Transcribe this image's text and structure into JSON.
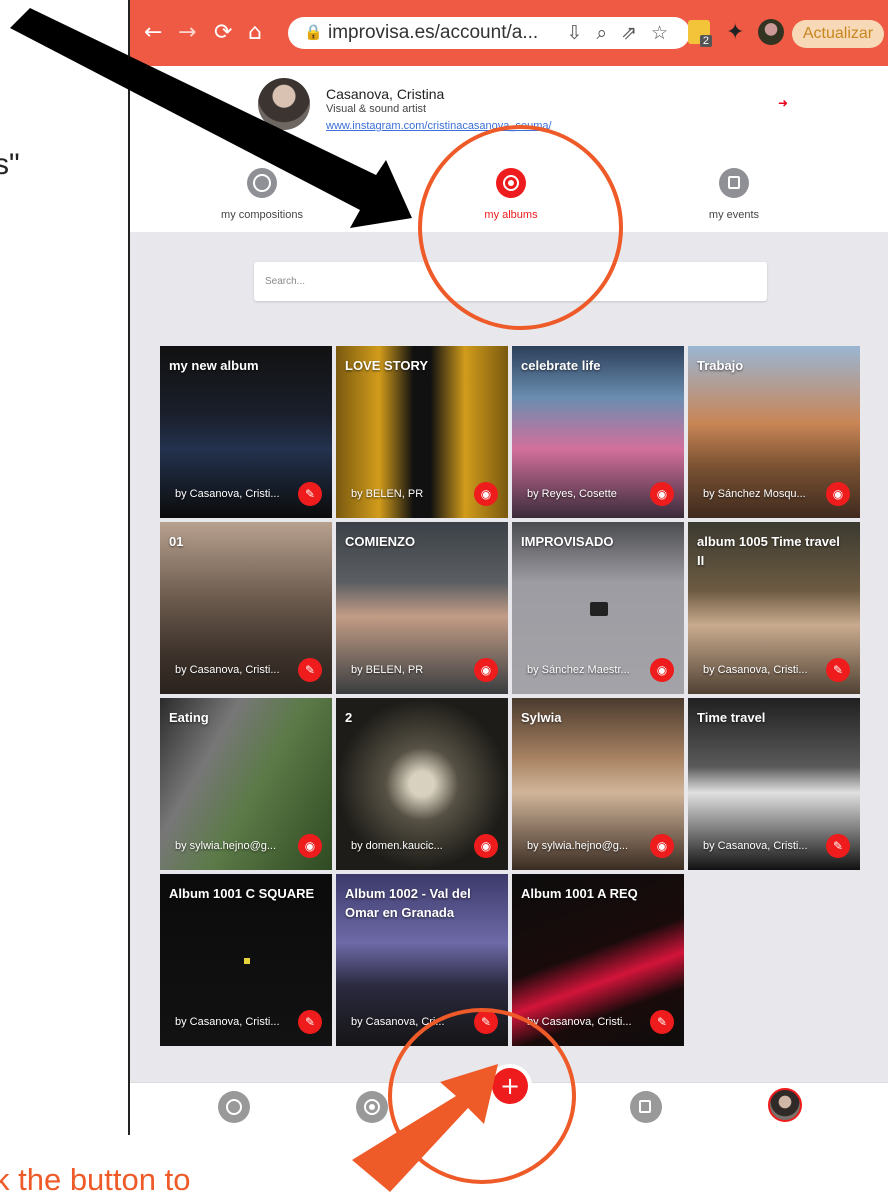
{
  "annotations": {
    "quote_fragment": "s\"",
    "bottom_text": "k the button to"
  },
  "browser": {
    "url": "improvisa.es/account/a...",
    "update_label": "Actualizar",
    "extension_badge": "2"
  },
  "profile": {
    "name": "Casanova, Cristina",
    "role": "Visual & sound artist",
    "link": "www.instagram.com/cristinacasanova_seuma/"
  },
  "tabs": [
    {
      "label": "my compositions",
      "icon": "play-circle-icon"
    },
    {
      "label": "my albums",
      "icon": "album-icon",
      "active": true
    },
    {
      "label": "my events",
      "icon": "calendar-icon"
    }
  ],
  "search": {
    "placeholder": "Search..."
  },
  "albums": [
    {
      "title": "my new album",
      "author": "by Casanova, Cristi...",
      "action": "edit"
    },
    {
      "title": "LOVE STORY",
      "author": "by BELEN, PR",
      "action": "view"
    },
    {
      "title": "celebrate life",
      "author": "by Reyes, Cosette",
      "action": "view"
    },
    {
      "title": "Trabajo",
      "author": "by Sánchez Mosqu...",
      "action": "view"
    },
    {
      "title": "01",
      "author": "by Casanova, Cristi...",
      "action": "edit"
    },
    {
      "title": "COMIENZO",
      "author": "by BELEN, PR",
      "action": "view"
    },
    {
      "title": "IMPROVISADO",
      "author": "by Sánchez Maestr...",
      "action": "view"
    },
    {
      "title": "album 1005 Time travel II",
      "author": "by Casanova, Cristi...",
      "action": "edit"
    },
    {
      "title": "Eating",
      "author": "by sylwia.hejno@g...",
      "action": "view"
    },
    {
      "title": "2",
      "author": "by domen.kaucic...",
      "action": "view"
    },
    {
      "title": "Sylwia",
      "author": "by sylwia.hejno@g...",
      "action": "view"
    },
    {
      "title": "Time travel",
      "author": "by Casanova, Cristi...",
      "action": "edit"
    },
    {
      "title": "Album 1001 C SQUARE",
      "author": "by Casanova, Cristi...",
      "action": "edit"
    },
    {
      "title": "Album 1002 - Val del Omar en Granada",
      "author": "by Casanova, Cri...",
      "action": "edit"
    },
    {
      "title": "Album 1001 A REQ",
      "author": "by Casanova, Cristi...",
      "action": "edit"
    }
  ],
  "colors": {
    "accent": "#ee1c1c",
    "annotation": "#ee5a28",
    "chrome": "#ee5a44"
  }
}
